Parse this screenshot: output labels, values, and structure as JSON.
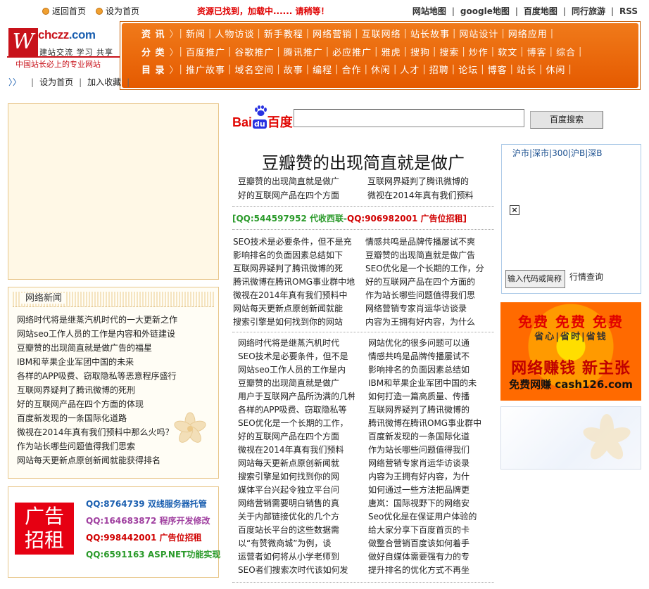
{
  "top": {
    "home": "返回首页",
    "sethome": "设为首页",
    "notice": "资源已找到，加载中......  请稍等！",
    "links": [
      "网站地图",
      "google地图",
      "百度地图",
      "同行旅游",
      "RSS"
    ]
  },
  "logo": {
    "mark": "W",
    "brand_prefix": "chczz",
    "brand_suffix": ".com",
    "sub": "建站交流 学习 共享",
    "tag": "中国站长必上的专业网站"
  },
  "nav": {
    "rows": [
      {
        "label": "资 讯",
        "items": [
          "新闻",
          "人物访谈",
          "新手教程",
          "网络营销",
          "互联网络",
          "站长故事",
          "网站设计",
          "网络应用"
        ]
      },
      {
        "label": "分 类",
        "items": [
          "百度推广",
          "谷歌推广",
          "腾讯推广",
          "必应推广",
          "雅虎",
          "搜狗",
          "搜索",
          "炒作",
          "软文",
          "博客",
          "综合"
        ]
      },
      {
        "label": "目 录",
        "items": [
          "推广故事",
          "域名空间",
          "故事",
          "编程",
          "合作",
          "休闲",
          "人才",
          "招聘",
          "论坛",
          "博客",
          "站长",
          "休闲"
        ]
      }
    ]
  },
  "subbar": {
    "sethome": "设为首页",
    "fav": "加入收藏"
  },
  "news": {
    "title": "网络新闻",
    "items": [
      "网络时代将是继蒸汽机时代的一大更新之作",
      "网站seo工作人员的工作是内容和外链建设",
      "豆瓣赞的出现简直就是做广告的福星",
      "IBM和苹果企业军团中国的未来",
      "各样的APP吸费、窃取隐私等恶意程序盛行",
      "互联网界疑判了腾讯微博的死刑",
      "好的互联网产品在四个方面的体现",
      "百度新发现的一条国际化道路",
      "微视在2014年真有我们预料中那么火吗？",
      "作为站长哪些问题值得我们思索",
      "网站每天更新点原创新闻就能获得排名"
    ]
  },
  "ad": {
    "red_line1": "广告",
    "red_line2": "招租",
    "lines": [
      {
        "text": "QQ:8764739 双线服务器托管",
        "color": "#1a5fb0"
      },
      {
        "text": "QQ:164683872 程序开发修改",
        "color": "#a040a0"
      },
      {
        "text": "QQ:998442001 广告位招租",
        "color": "#d00000"
      },
      {
        "text": "QQ:6591163 ASP.NET功能实现",
        "color": "#2a9a2a"
      }
    ]
  },
  "search": {
    "button": "百度搜索",
    "logo_left": "Bai",
    "logo_mid": "du",
    "logo_right": "百度"
  },
  "center": {
    "headline": "豆瓣赞的出现简直就是做广",
    "sub_left": [
      "豆瓣赞的出现简直就是做广",
      "好的互联网产品在四个方面"
    ],
    "sub_right": [
      "互联网界疑判了腾讯微博的",
      "微视在2014年真有我们预料"
    ],
    "qq_a": "[QQ:544597952 代收西联-",
    "qq_b": "QQ:906982001 广告位招租]",
    "block1_left": [
      "SEO技术是必要条件，但不是充",
      "影响排名的负面因素总结如下",
      "互联网界疑判了腾讯微博的死",
      "腾讯微博在腾讯OMG事业群中地",
      "微视在2014年真有我们预料中",
      "网站每天更新点原创新闻就能",
      "搜索引擎是如何找到你的网站"
    ],
    "block1_right": [
      "情感共鸣是品牌传播屡试不爽",
      "豆瓣赞的出现简直就是做广告",
      "SEO优化是一个长期的工作，分",
      "好的互联网产品在四个方面的",
      "作为站长哪些问题值得我们思",
      "网络营销专家肖运华访谈录",
      "内容为王拥有好内容，为什么"
    ],
    "block2_left": [
      "网络时代将是继蒸汽机时代",
      "SEO技术是必要条件，但不是",
      "网站seo工作人员的工作是内",
      "豆瓣赞的出现简直就是做广",
      "用户于互联网产品所沩满的几种角",
      "各样的APP吸费、窃取隐私等",
      "SEO优化是一个长期的工作，",
      "好的互联网产品在四个方面",
      "微视在2014年真有我们预料",
      "网站每天更新点原创新闻就",
      "搜索引擎是如何找到你的网",
      "媒体平台兴起令独立平台问",
      "网络营销需要明白销售的真",
      "关于内部链接优化的几个方",
      "百度站长平台的这些数据需",
      "以“有赞微商城”为例，谈",
      "运营者如何将从小学老师到",
      "SEO者们搜索次时代该如何发"
    ],
    "block2_right": [
      "网站优化的很多问题可以通",
      "情感共鸣是品牌传播屡试不",
      "影响排名的负面因素总结如",
      "IBM和苹果企业军团中国的未",
      "如何打造一篇高质量、传播",
      "互联网界疑判了腾讯微博的",
      "腾讯微博在腾讯OMG事业群中",
      "百度新发现的一条国际化道",
      "作为站长哪些问题值得我们",
      "网络营销专家肖运华访谈录",
      "内容为王拥有好内容，为什",
      "如何通过一些方法把品牌更",
      "唐岚：国际视野下的网络安",
      "Seo优化是在保证用户体验的",
      "给大家分享下百度首页的卡",
      "做整合营销百度该如何着手",
      "做好自媒体需要强有力的专",
      "提升排名的优化方式不再坐"
    ]
  },
  "stock": {
    "tabs": "沪市|深市|300|沪B|深B",
    "close": "×",
    "input_value": "输入代码或简称",
    "query": "行情查询"
  },
  "cashad": {
    "line1": "免费 免费 免费",
    "line2": "省心|省时|省钱",
    "line3": "网络赚钱 新主张",
    "line4": "免费网赚 cash126.com"
  }
}
